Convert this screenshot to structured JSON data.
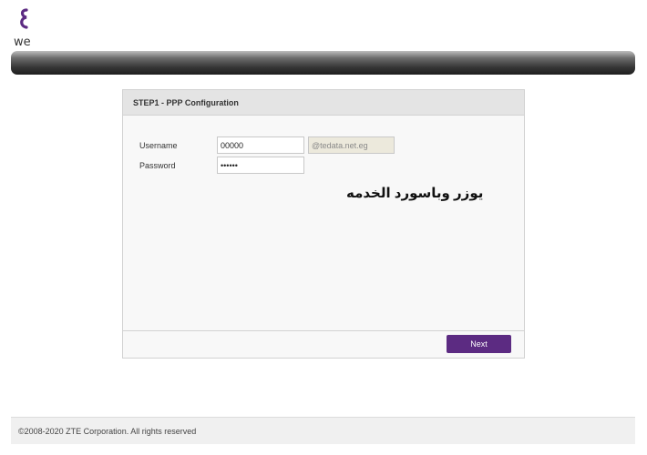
{
  "brand": {
    "logo_text": "we",
    "accent_color": "#5c2b82"
  },
  "panel": {
    "title": "STEP1 - PPP Configuration",
    "username_label": "Username",
    "username_value": "00000",
    "domain_value": "@tedata.net.eg",
    "password_label": "Password",
    "password_value": "••••••",
    "annotation": "يوزر وباسورد الخدمه",
    "next_label": "Next"
  },
  "footer": {
    "copyright": "©2008-2020 ZTE Corporation. All rights reserved"
  }
}
